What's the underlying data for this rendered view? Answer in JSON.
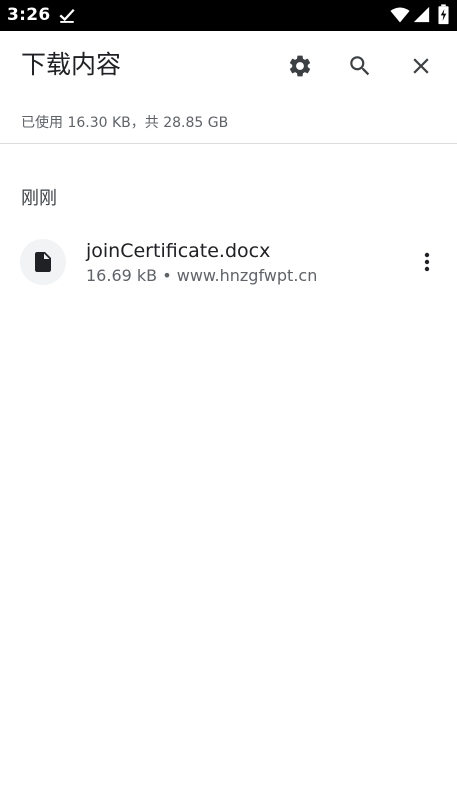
{
  "status_bar": {
    "time": "3:26"
  },
  "header": {
    "title": "下载内容",
    "icons": {
      "settings": "gear-icon",
      "search": "search-icon",
      "close": "close-icon"
    }
  },
  "storage": {
    "summary": "已使用 16.30 KB，共 28.85 GB"
  },
  "sections": [
    {
      "header": "刚刚",
      "items": [
        {
          "file_name": "joinCertificate.docx",
          "meta": "16.69 kB • www.hnzgfwpt.cn",
          "icon": "file-icon"
        }
      ]
    }
  ],
  "colors": {
    "text_primary": "#202124",
    "text_secondary": "#5f6368",
    "icon": "#3c4043",
    "status_bar": "#000000",
    "divider": "#dadce0",
    "thumb_bg": "#f1f3f4"
  }
}
